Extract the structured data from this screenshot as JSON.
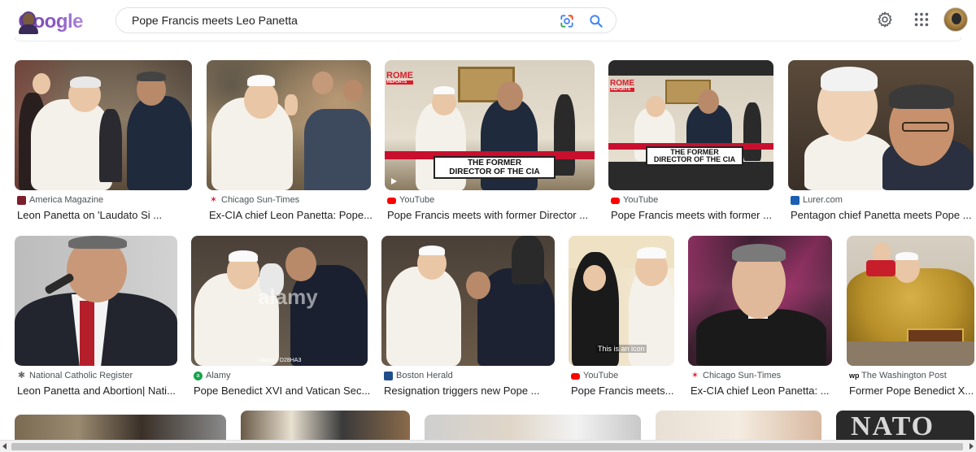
{
  "header": {
    "logo_text": "Google",
    "search_query": "Pope Francis meets Leo Panetta",
    "lens_icon": "google-lens-icon",
    "search_icon": "search-icon",
    "settings_icon": "gear-icon",
    "apps_icon": "apps-grid-icon"
  },
  "colors": {
    "link_blue": "#1a73e8",
    "text_primary": "#202124",
    "text_secondary": "#4d5156",
    "youtube_red": "#ff0000",
    "sun_times_red": "#d7263d"
  },
  "results": [
    {
      "source": "America Magazine",
      "title": "Leon Panetta on 'Laudato Si ...",
      "favicon": "america-magazine-icon"
    },
    {
      "source": "Chicago Sun-Times",
      "title": "Ex-CIA chief Leon Panetta: Pope...",
      "favicon": "sun-times-icon"
    },
    {
      "source": "YouTube",
      "title": "Pope Francis meets with former Director ...",
      "favicon": "youtube-icon",
      "overlay": {
        "logo_top": "ROME",
        "logo_bottom": "REPORTS",
        "banner_line1": "THE FORMER",
        "banner_line2": "DIRECTOR OF THE CIA"
      }
    },
    {
      "source": "YouTube",
      "title": "Pope Francis meets with former ...",
      "favicon": "youtube-icon",
      "overlay": {
        "logo_top": "ROME",
        "logo_bottom": "REPORTS",
        "banner_line1": "THE FORMER",
        "banner_line2": "DIRECTOR OF THE CIA"
      }
    },
    {
      "source": "Lurer.com",
      "title": "Pentagon chief Panetta meets Pope ...",
      "favicon": "lurer-icon"
    },
    {
      "source": "National Catholic Register",
      "title": "Leon Panetta and Abortion| Nati...",
      "favicon": "ncr-icon"
    },
    {
      "source": "Alamy",
      "title": "Pope Benedict XVI and Vatican Sec...",
      "favicon": "alamy-icon",
      "overlay": {
        "watermark": "alamy",
        "stock_id": "alamy - D28HA3"
      }
    },
    {
      "source": "Boston Herald",
      "title": "Resignation triggers new Pope ...",
      "favicon": "boston-herald-icon"
    },
    {
      "source": "YouTube",
      "title": "Pope Francis meets...",
      "favicon": "youtube-icon",
      "overlay": {
        "caption": "This is an icon"
      }
    },
    {
      "source": "Chicago Sun-Times",
      "title": "Ex-CIA chief Leon Panetta: ...",
      "favicon": "sun-times-icon"
    },
    {
      "source": "The Washington Post",
      "title": "Former Pope Benedict X...",
      "favicon": "washington-post-icon"
    }
  ],
  "partial_row": {
    "visible_text": "NATO"
  }
}
